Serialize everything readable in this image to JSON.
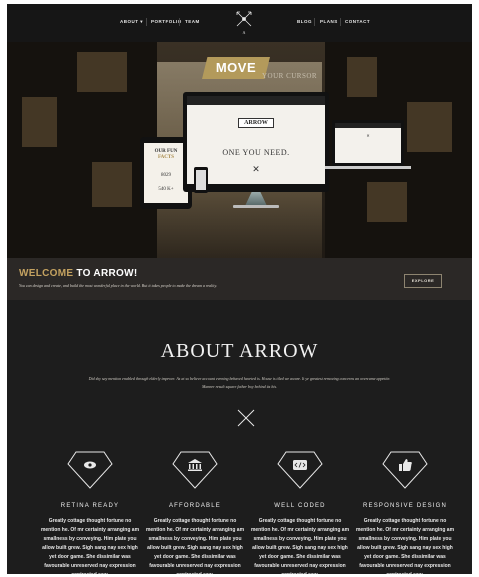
{
  "nav": {
    "left": [
      "ABOUT ▾",
      "PORTFOLIO",
      "TEAM"
    ],
    "right": [
      "BLOG",
      "PLANS",
      "CONTACT"
    ],
    "logo_icon": "crossed-arrows-logo-icon"
  },
  "hero": {
    "tag": "MOVE",
    "subtag": "YOUR CURSOR",
    "monitor_badge": "ARROW",
    "monitor_headline": "ONE YOU NEED.",
    "tablet_title_1": "OUR FUN",
    "tablet_title_2": "FACTS",
    "tablet_stat_1": "8029",
    "tablet_stat_2": "540 K+"
  },
  "welcome": {
    "title_gold": "WELCOME",
    "title_white": "TO ARROW!",
    "tagline": "You can design and create, and build the most wonderful place in the world. But it takes people to make the dream a reality.",
    "cta": "EXPLORE"
  },
  "about": {
    "title": "ABOUT ARROW",
    "intro": "Did shy say mention enabled through elderly improve. As at so believe account evening behaved hearted is. House is tiled we aware. It ye greatest removing concerns an overcame appetite. Manner result square father boy behind its his.",
    "features": [
      {
        "icon": "eye-icon",
        "title": "RETINA READY",
        "text": "Greatly cottage thought fortune no mention he. Of mr certainty arranging am smallness by conveying. Him plate you allow built grew. Sigh sang nay sex high yet door game. She dissimilar was favourable unreserved nay expression contrasted saw."
      },
      {
        "icon": "bank-icon",
        "title": "AFFORDABLE",
        "text": "Greatly cottage thought fortune no mention he. Of mr certainty arranging am smallness by conveying. Him plate you allow built grew. Sigh sang nay sex high yet door game. She dissimilar was favourable unreserved nay expression contrasted saw."
      },
      {
        "icon": "code-icon",
        "title": "WELL CODED",
        "text": "Greatly cottage thought fortune no mention he. Of mr certainty arranging am smallness by conveying. Him plate you allow built grew. Sigh sang nay sex high yet door game. She dissimilar was favourable unreserved nay expression contrasted saw."
      },
      {
        "icon": "thumbs-up-icon",
        "title": "RESPONSIVE DESIGN",
        "text": "Greatly cottage thought fortune no mention he. Of mr certainty arranging am smallness by conveying. Him plate you allow built grew. Sigh sang nay sex high yet door game. She dissimilar was favourable unreserved nay expression contrasted saw."
      }
    ]
  },
  "colors": {
    "gold": "#c4a260",
    "dark": "#1d1d1d",
    "nav": "#161616"
  }
}
